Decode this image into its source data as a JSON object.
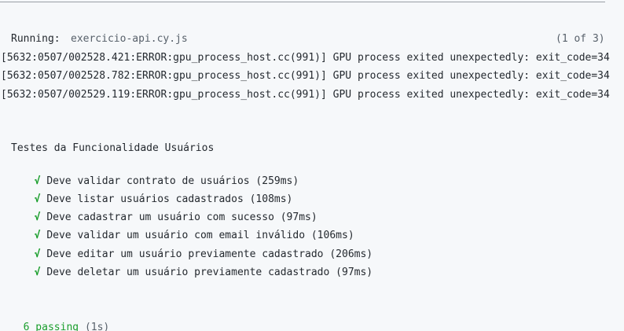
{
  "header": {
    "running_label": "Running:",
    "running_file": "exercicio-api.cy.js",
    "running_count": "(1 of 3)"
  },
  "errors": [
    "[5632:0507/002528.421:ERROR:gpu_process_host.cc(991)] GPU process exited unexpectedly: exit_code=34",
    "[5632:0507/002528.782:ERROR:gpu_process_host.cc(991)] GPU process exited unexpectedly: exit_code=34",
    "[5632:0507/002529.119:ERROR:gpu_process_host.cc(991)] GPU process exited unexpectedly: exit_code=34"
  ],
  "suite": {
    "title": "Testes da Funcionalidade Usuários",
    "check_glyph": "√",
    "tests": [
      "Deve validar contrato de usuários (259ms)",
      "Deve listar usuários cadastrados (108ms)",
      "Deve cadastrar um usuário com sucesso (97ms)",
      "Deve validar um usuário com email inválido (106ms)",
      "Deve editar um usuário previamente cadastrado (206ms)",
      "Deve deletar um usuário previamente cadastrado (97ms)"
    ]
  },
  "summary": {
    "passing": "6 passing",
    "duration": "(1s)"
  },
  "colors": {
    "background": "#f6f8fa",
    "pass_green": "#1a9e2c",
    "text": "#24292f",
    "muted": "#57606a"
  }
}
